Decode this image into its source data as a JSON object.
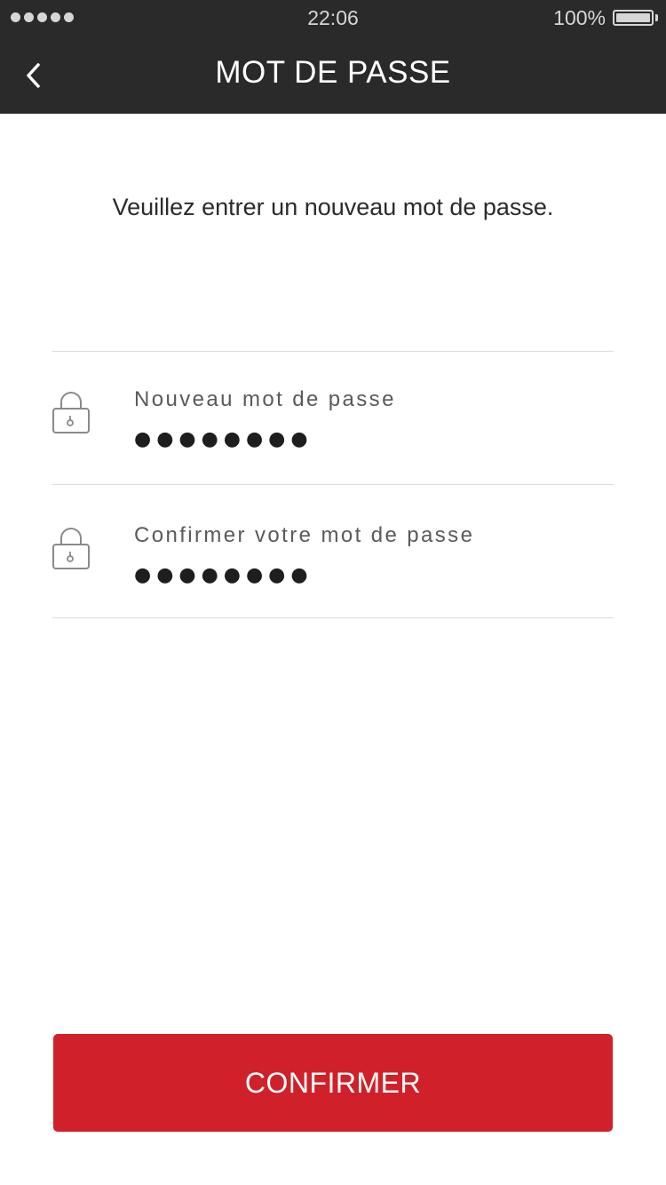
{
  "status_bar": {
    "time": "22:06",
    "battery": "100%",
    "signal_icon": "signal-dots-icon",
    "battery_icon": "battery-icon"
  },
  "nav": {
    "title": "MOT DE PASSE",
    "back_icon": "chevron-left-icon"
  },
  "instructions": "Veuillez entrer un nouveau mot de passe.",
  "fields": [
    {
      "label": "Nouveau mot de passe",
      "value": "●●●●●●●●",
      "icon": "lock-icon"
    },
    {
      "label": "Confirmer votre mot de passe",
      "value": "●●●●●●●●",
      "icon": "lock-icon"
    }
  ],
  "confirm_button": {
    "label": "CONFIRMER"
  },
  "colors": {
    "header_bg": "#2a2a2a",
    "accent": "#d0202a",
    "divider": "#dcdcdc"
  }
}
